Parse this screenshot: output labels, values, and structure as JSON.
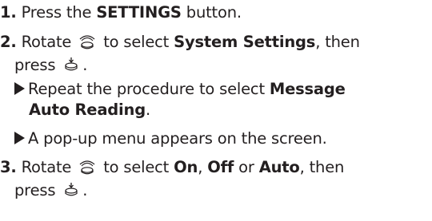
{
  "steps": [
    {
      "num": "1.",
      "t1": "Press the ",
      "b1": "SETTINGS",
      "t2": " button."
    },
    {
      "num": "2.",
      "t1": "Rotate ",
      "t2": " to select ",
      "b1": "System Settings",
      "t3": ", then",
      "cont_text": "press ",
      "cont_end": ".",
      "substeps": [
        {
          "t1": "Repeat the procedure to select ",
          "b1": "Message",
          "b2": "Auto Reading",
          "t2": "."
        },
        {
          "t1": "A pop-up menu appears on the screen."
        }
      ]
    },
    {
      "num": "3.",
      "t1": "Rotate ",
      "t2": " to select ",
      "b1": "On",
      "t3": ", ",
      "b2": "Off",
      "t4": " or ",
      "b3": "Auto",
      "t5": ", then",
      "cont_text": "press ",
      "cont_end": "."
    }
  ],
  "icons": {
    "rotate": "rotate-knob-icon",
    "press": "press-knob-icon",
    "bullet": "triangle-bullet-icon"
  }
}
